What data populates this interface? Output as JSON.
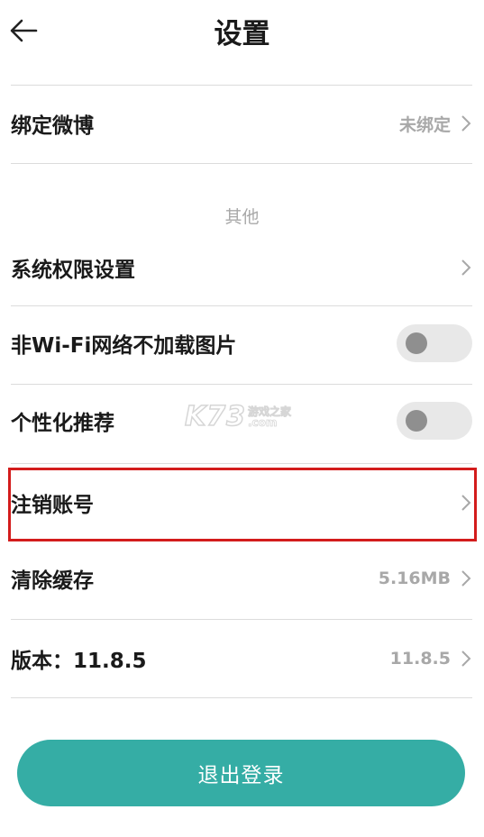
{
  "header": {
    "title": "设置",
    "back_icon": "arrow-left-icon"
  },
  "rows": {
    "weibo": {
      "label": "绑定微博",
      "value": "未绑定"
    },
    "section_other": "其他",
    "permissions": {
      "label": "系统权限设置"
    },
    "no_wifi_images": {
      "label": "非Wi-Fi网络不加载图片",
      "enabled": false
    },
    "personalized": {
      "label": "个性化推荐",
      "enabled": false
    },
    "cancel_account": {
      "label": "注销账号"
    },
    "clear_cache": {
      "label": "清除缓存",
      "value": "5.16MB"
    },
    "version": {
      "label": "版本：11.8.5",
      "value": "11.8.5"
    }
  },
  "watermark": {
    "brand": "K73",
    "tagline": "游戏之家",
    "domain": ".com"
  },
  "logout": {
    "label": "退出登录"
  },
  "colors": {
    "accent": "#35ada5",
    "highlight": "#d31c1c",
    "muted": "#a8a8a8"
  }
}
